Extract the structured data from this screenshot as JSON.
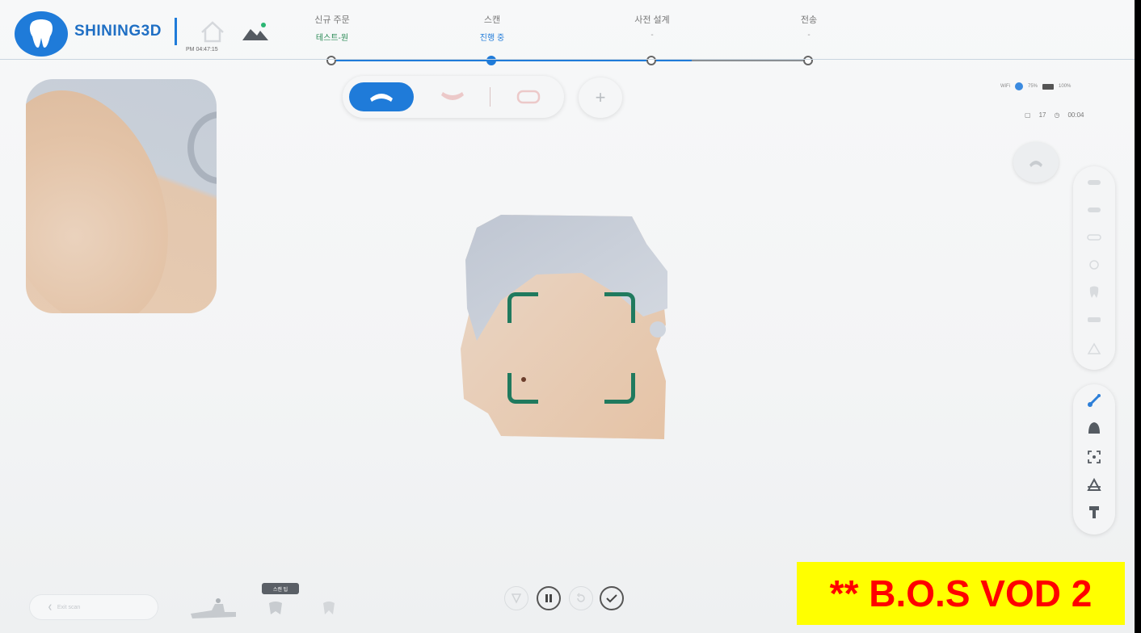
{
  "header": {
    "brand": "SHINING3D",
    "datetime": "PM 04:47:15",
    "steps": [
      {
        "title": "신규 주문",
        "sub": "테스트-원"
      },
      {
        "title": "스캔",
        "sub": "진행 중"
      },
      {
        "title": "사전 설계",
        "sub": "-"
      },
      {
        "title": "전송",
        "sub": "-"
      }
    ]
  },
  "status": {
    "network": "WiFi",
    "signal": "75%",
    "battery": "100%",
    "frame_count": "17",
    "elapsed": "00:04"
  },
  "add_button": "+",
  "bottom": {
    "exit_label": "Exit scan",
    "tooltip": "스캔 팁"
  },
  "watermark": "** B.O.S VOD 2",
  "icons": {
    "logo": "tooth-icon",
    "home": "home-icon",
    "cloud": "cloud-sync-icon",
    "pause": "pause-icon",
    "check": "check-icon",
    "undo": "undo-icon",
    "bookmark": "bookmark-icon"
  },
  "colors": {
    "brand_blue": "#1f7bd9",
    "frame_green": "#207a5e",
    "watermark_bg": "#ffff00",
    "watermark_text": "#ff0000"
  }
}
